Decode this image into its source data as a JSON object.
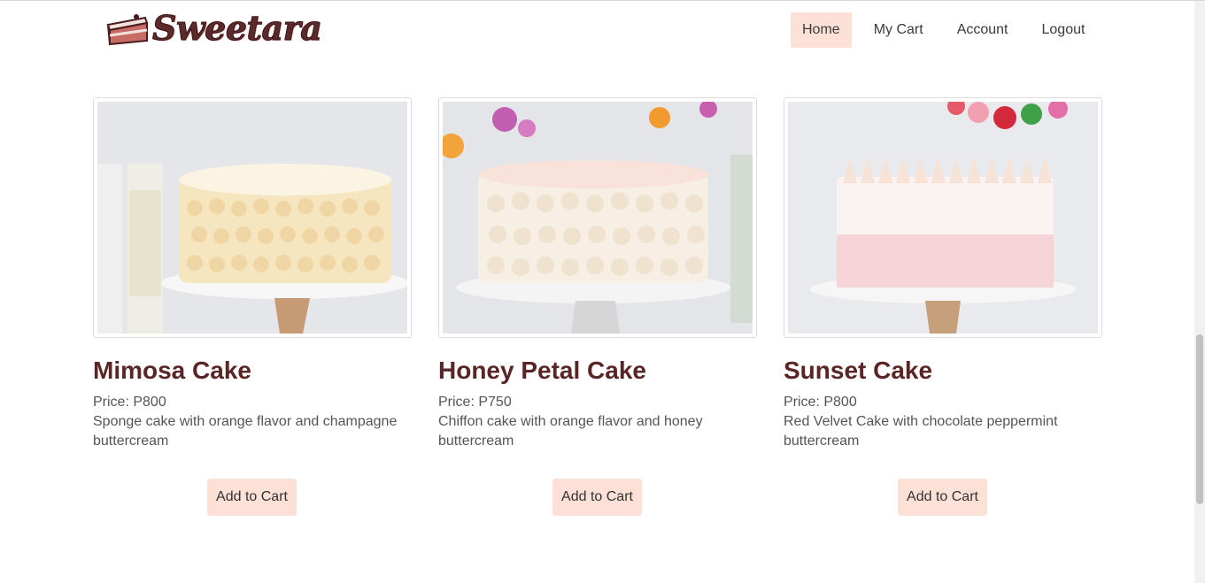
{
  "brand": {
    "name": "Sweetara",
    "logo_icon": "cake-slice-icon"
  },
  "nav": {
    "items": [
      {
        "label": "Home",
        "active": true
      },
      {
        "label": "My Cart",
        "active": false
      },
      {
        "label": "Account",
        "active": false
      },
      {
        "label": "Logout",
        "active": false
      }
    ]
  },
  "products": [
    {
      "name": "Mimosa Cake",
      "price": "Price: P800",
      "description": "Sponge cake with orange flavor and champagne buttercream",
      "button": "Add to Cart"
    },
    {
      "name": "Honey Petal Cake",
      "price": "Price: P750",
      "description": "Chiffon cake with orange flavor and honey buttercream",
      "button": "Add to Cart"
    },
    {
      "name": "Sunset Cake",
      "price": "Price: P800",
      "description": "Red Velvet Cake with chocolate peppermint buttercream",
      "button": "Add to Cart"
    }
  ],
  "colors": {
    "accent": "#fde0d6",
    "title": "#5a2525",
    "brand": "#5a2a2c"
  }
}
